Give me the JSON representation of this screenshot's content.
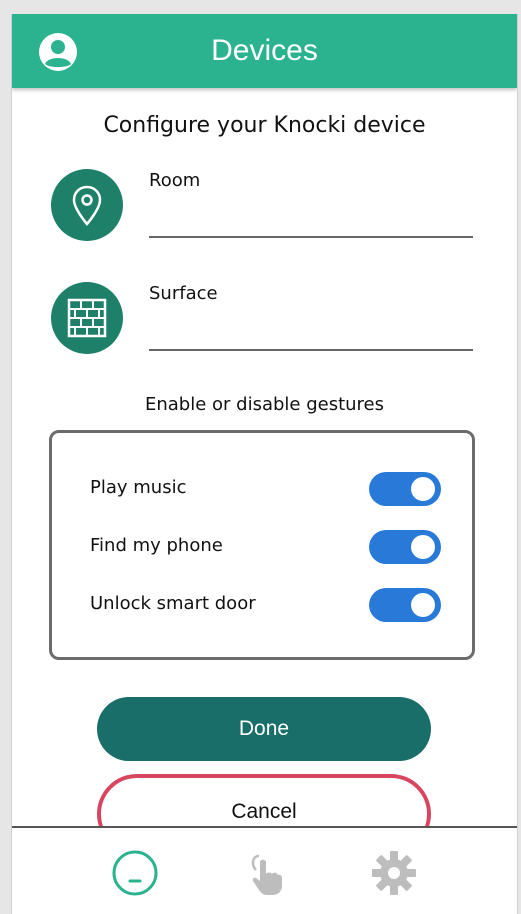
{
  "header": {
    "title": "Devices",
    "avatar_icon": "account-circle-icon"
  },
  "config": {
    "title": "Configure your Knocki device",
    "fields": [
      {
        "label": "Room",
        "icon": "location-pin-icon",
        "value": ""
      },
      {
        "label": "Surface",
        "icon": "brick-wall-icon",
        "value": ""
      }
    ]
  },
  "gestures": {
    "title": "Enable or disable gestures",
    "items": [
      {
        "label": "Play music",
        "enabled": true
      },
      {
        "label": "Find my phone",
        "enabled": true
      },
      {
        "label": "Unlock smart door",
        "enabled": true
      }
    ]
  },
  "actions": {
    "done_label": "Done",
    "cancel_label": "Cancel"
  },
  "bottom_nav": [
    {
      "icon": "knocki-device-icon",
      "active": true
    },
    {
      "icon": "tap-gesture-icon",
      "active": false
    },
    {
      "icon": "settings-gear-icon",
      "active": false
    }
  ],
  "colors": {
    "accent": "#2bb38f",
    "icon_bg": "#1e8069",
    "toggle_on": "#2979d8",
    "done_button": "#1a6e69",
    "cancel_border": "#d8455f"
  }
}
